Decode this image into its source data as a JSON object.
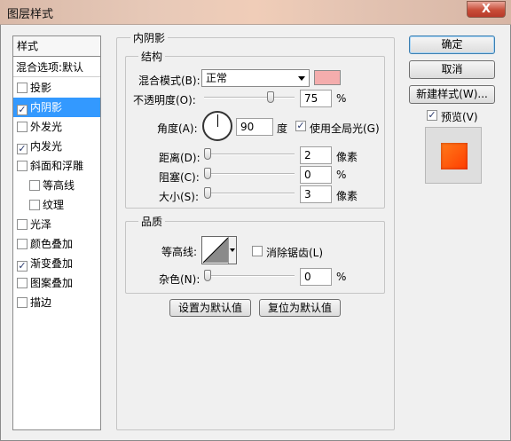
{
  "window": {
    "title": "图层样式",
    "close_glyph": "X"
  },
  "styles_panel": {
    "header": "样式",
    "blend_item": "混合选项:默认",
    "items": [
      {
        "label": "投影",
        "checked": false
      },
      {
        "label": "内阴影",
        "checked": true,
        "selected": true
      },
      {
        "label": "外发光",
        "checked": false
      },
      {
        "label": "内发光",
        "checked": true
      },
      {
        "label": "斜面和浮雕",
        "checked": false
      },
      {
        "label": "等高线",
        "checked": false
      },
      {
        "label": "纹理",
        "checked": false
      },
      {
        "label": "光泽",
        "checked": false
      },
      {
        "label": "颜色叠加",
        "checked": false
      },
      {
        "label": "渐变叠加",
        "checked": true
      },
      {
        "label": "图案叠加",
        "checked": false
      },
      {
        "label": "描边",
        "checked": false
      }
    ]
  },
  "inner_shadow": {
    "title": "内阴影",
    "structure": {
      "title": "结构",
      "blend_mode_label": "混合模式(B):",
      "blend_mode_value": "正常",
      "shadow_color": "#f4adad",
      "opacity_label": "不透明度(O):",
      "opacity_value": "75",
      "opacity_unit": "%",
      "angle_label": "角度(A):",
      "angle_value": "90",
      "angle_unit": "度",
      "global_light_label": "使用全局光(G)",
      "global_light_checked": true,
      "distance_label": "距离(D):",
      "distance_value": "2",
      "distance_unit": "像素",
      "choke_label": "阻塞(C):",
      "choke_value": "0",
      "choke_unit": "%",
      "size_label": "大小(S):",
      "size_value": "3",
      "size_unit": "像素"
    },
    "quality": {
      "title": "品质",
      "contour_label": "等高线:",
      "antialias_label": "消除锯齿(L)",
      "antialias_checked": false,
      "noise_label": "杂色(N):",
      "noise_value": "0",
      "noise_unit": "%"
    },
    "make_default": "设置为默认值",
    "reset_default": "复位为默认值"
  },
  "actions": {
    "ok": "确定",
    "cancel": "取消",
    "new_style": "新建样式(W)...",
    "preview_label": "预览(V)",
    "preview_checked": true
  },
  "check_glyph": "✓"
}
